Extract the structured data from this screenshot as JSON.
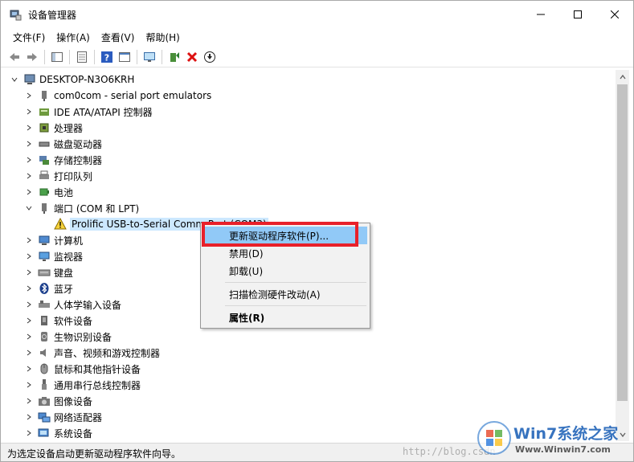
{
  "window": {
    "title": "设备管理器"
  },
  "menu": [
    "文件(F)",
    "操作(A)",
    "查看(V)",
    "帮助(H)"
  ],
  "tree": {
    "root": "DESKTOP-N3O6KRH",
    "items": [
      {
        "label": "com0com - serial port emulators",
        "icon": "serial-port-icon",
        "expanded": false
      },
      {
        "label": "IDE ATA/ATAPI 控制器",
        "icon": "ide-controller-icon",
        "expanded": false
      },
      {
        "label": "处理器",
        "icon": "processor-icon",
        "expanded": false
      },
      {
        "label": "磁盘驱动器",
        "icon": "disk-drive-icon",
        "expanded": false
      },
      {
        "label": "存储控制器",
        "icon": "storage-controller-icon",
        "expanded": false
      },
      {
        "label": "打印队列",
        "icon": "printer-icon",
        "expanded": false
      },
      {
        "label": "电池",
        "icon": "battery-icon",
        "expanded": false
      },
      {
        "label": "端口 (COM 和 LPT)",
        "icon": "port-icon",
        "expanded": true
      },
      {
        "label": "Prolific USB-to-Serial Comm Port (COM3)",
        "icon": "warning-icon",
        "child": true
      },
      {
        "label": "计算机",
        "icon": "computer-icon",
        "expanded": false
      },
      {
        "label": "监视器",
        "icon": "monitor-icon",
        "expanded": false
      },
      {
        "label": "键盘",
        "icon": "keyboard-icon",
        "expanded": false
      },
      {
        "label": "蓝牙",
        "icon": "bluetooth-icon",
        "expanded": false
      },
      {
        "label": "人体学输入设备",
        "icon": "hid-icon",
        "expanded": false
      },
      {
        "label": "软件设备",
        "icon": "software-device-icon",
        "expanded": false
      },
      {
        "label": "生物识别设备",
        "icon": "biometric-icon",
        "expanded": false
      },
      {
        "label": "声音、视频和游戏控制器",
        "icon": "sound-icon",
        "expanded": false
      },
      {
        "label": "鼠标和其他指针设备",
        "icon": "mouse-icon",
        "expanded": false
      },
      {
        "label": "通用串行总线控制器",
        "icon": "usb-icon",
        "expanded": false
      },
      {
        "label": "图像设备",
        "icon": "camera-icon",
        "expanded": false
      },
      {
        "label": "网络适配器",
        "icon": "network-icon",
        "expanded": false
      },
      {
        "label": "系统设备",
        "icon": "system-device-icon",
        "expanded": false
      }
    ]
  },
  "context_menu": {
    "update": "更新驱动程序软件(P)...",
    "disable": "禁用(D)",
    "uninstall": "卸载(U)",
    "scan": "扫描检测硬件改动(A)",
    "properties": "属性(R)"
  },
  "status": "为选定设备启动更新驱动程序软件向导。",
  "watermark": {
    "brand": "Win7系统之家",
    "url": "http://blog.csdn",
    "site": "Www.Winwin7.com"
  },
  "colors": {
    "highlight": "#91c9f7",
    "annotation": "#e8202a",
    "selection": "#cce8ff"
  }
}
